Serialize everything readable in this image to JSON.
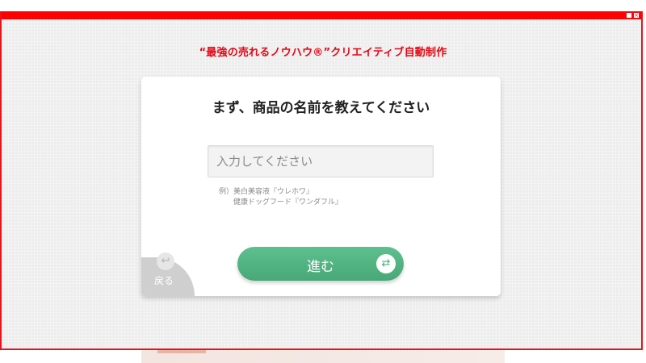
{
  "window": {
    "minimize_icon": "minimize-icon",
    "close_icon": "close-icon",
    "minimize_glyph": "_",
    "close_glyph": "×"
  },
  "headline": "“最強の売れるノウハウ®”クリエイティブ自動制作",
  "card": {
    "title": "まず、商品の名前を教えてください",
    "input_placeholder": "入力してください",
    "input_value": "",
    "examples_line1": "例）美白美容液『ウレホワ』",
    "examples_line2": "健康ドッグフード『ワンダフル』"
  },
  "buttons": {
    "back_label": "戻る",
    "back_icon": "return-arrow-icon",
    "back_glyph": "↩",
    "next_label": "進む",
    "next_icon": "cycle-arrow-icon",
    "next_glyph": "⇄"
  },
  "colors": {
    "frame_red": "#e8141b",
    "headline_red": "#e30613",
    "button_green": "#4caf7d",
    "back_gray": "#cfcfcf"
  }
}
